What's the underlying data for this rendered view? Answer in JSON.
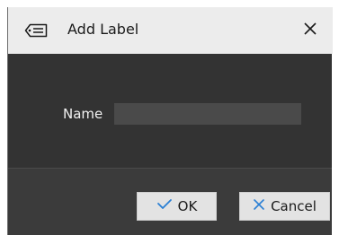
{
  "dialog": {
    "title": "Add Label",
    "title_icon": "label-tag-icon",
    "close_icon": "close-icon"
  },
  "form": {
    "name_label": "Name",
    "name_value": "",
    "name_placeholder": ""
  },
  "buttons": {
    "ok_label": "OK",
    "ok_icon": "checkmark-icon",
    "cancel_label": "Cancel",
    "cancel_icon": "cross-icon"
  },
  "colors": {
    "accent": "#2a7fd4",
    "titlebar_bg": "#ececec",
    "body_bg": "#333333",
    "footer_bg": "#3b3b3b",
    "button_bg": "#e3e3e3"
  }
}
